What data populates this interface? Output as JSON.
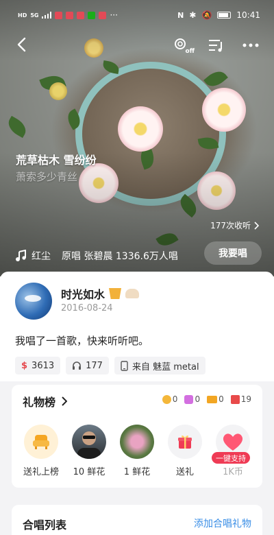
{
  "status_bar": {
    "left_icons": [
      "hd-icon",
      "signal-5g-icon",
      "wifi-bars-icon",
      "app-notification-icon",
      "mail-icon",
      "app-notification-icon",
      "wechat-icon",
      "app-notification-icon"
    ],
    "more_glyph": "···",
    "network_label": "5G",
    "right_icons": [
      "nfc-icon",
      "bluetooth-icon",
      "mute-icon",
      "battery-icon"
    ],
    "time": "10:41"
  },
  "top_nav": {
    "off_label": "off"
  },
  "song": {
    "lyric_line_1": "荒草枯木 雪纷纷",
    "lyric_line_2": "萧索多少青丝",
    "collect_count": "177次收听",
    "name": "红尘",
    "meta": "原唱 张碧晨 1336.6万人唱",
    "sing_button": "我要唱"
  },
  "user": {
    "name": "时光如水",
    "level_badge": "5",
    "badge2": "0",
    "date": "2016-08-24",
    "post_text": "我唱了一首歌，快来听听吧。"
  },
  "stats": {
    "coins": "3613",
    "listens": "177",
    "source": "来自 魅蓝 metal"
  },
  "gift": {
    "title": "礼物榜",
    "counts": [
      {
        "icon": "gold-coin-icon",
        "value": "0",
        "color": "#f4b73a"
      },
      {
        "icon": "purple-gem-icon",
        "value": "0",
        "color": "#d36fe0"
      },
      {
        "icon": "ticket-icon",
        "value": "0",
        "color": "#f2a623"
      },
      {
        "icon": "red-envelope-icon",
        "value": "19",
        "color": "#e84a4a"
      }
    ],
    "items": [
      {
        "label": "送礼上榜"
      },
      {
        "label": "10 鲜花"
      },
      {
        "label": "1 鲜花"
      },
      {
        "label": "送礼"
      },
      {
        "label": "1K币",
        "tag": "一键支持"
      }
    ]
  },
  "chorus": {
    "title": "合唱列表",
    "link": "添加合唱礼物"
  },
  "colors": {
    "accent_red": "#ef3b55",
    "link_blue": "#3a8ee6",
    "gold": "#f2b13a"
  }
}
